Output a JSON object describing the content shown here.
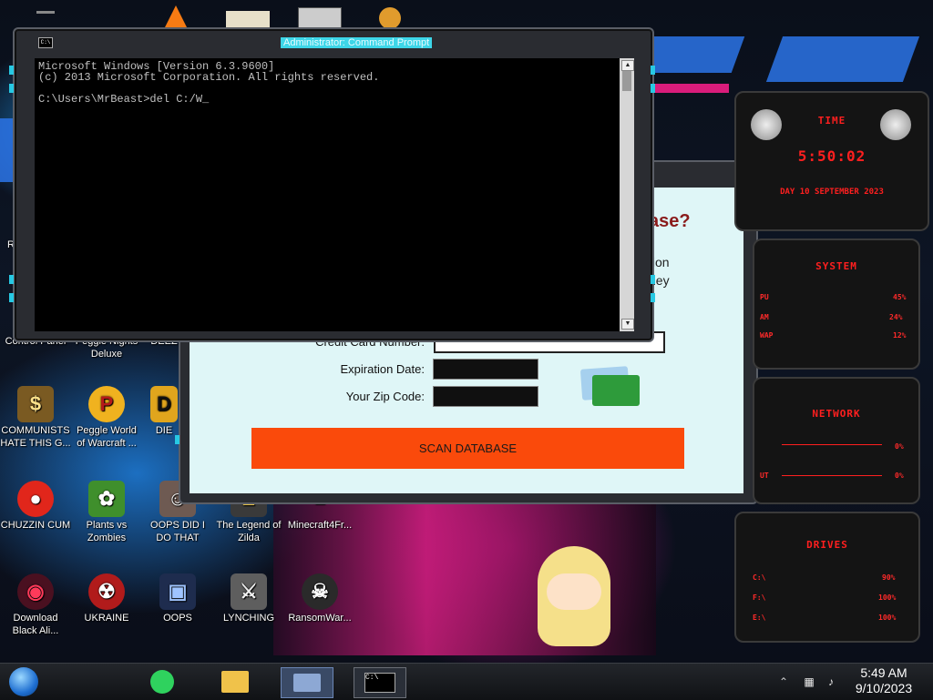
{
  "desktop": {
    "icons": [
      {
        "label": "Control Panel",
        "glyph": "⚙"
      },
      {
        "label": "Peggle Nights Deluxe",
        "glyph": "P"
      },
      {
        "label": "DEEZ",
        "glyph": "D"
      },
      {
        "label": "COMMUNISTS HATE THIS G...",
        "glyph": "$"
      },
      {
        "label": "Peggle World of Warcraft ...",
        "glyph": "P"
      },
      {
        "label": "DIE",
        "glyph": "D"
      },
      {
        "label": "CHUZZIN CUM",
        "glyph": "●"
      },
      {
        "label": "Plants vs Zombies",
        "glyph": "✿"
      },
      {
        "label": "OOPS DID I DO THAT",
        "glyph": "☺"
      },
      {
        "label": "The Legend of Zilda",
        "glyph": "▲"
      },
      {
        "label": "Minecraft4Fr...",
        "glyph": "■"
      },
      {
        "label": "Download Black Ali...",
        "glyph": "◉"
      },
      {
        "label": "UKRAINE",
        "glyph": "☢"
      },
      {
        "label": "OOPS",
        "glyph": "▣"
      },
      {
        "label": "LYNCHING",
        "glyph": "⚔"
      },
      {
        "label": "RansomWar...",
        "glyph": "☠"
      },
      {
        "label": "Re",
        "glyph": "♻"
      }
    ]
  },
  "cmd": {
    "title": "Administrator: Command Prompt",
    "icon_text": "C:\\",
    "lines": [
      "Microsoft Windows [Version 6.3.9600]",
      "(c) 2013 Microsoft Corporation. All rights reserved.",
      "",
      "C:\\Users\\MrBeast>del C:/W_"
    ]
  },
  "scam": {
    "heading_fragment": "ase?",
    "text_lines": [
      "tion",
      "ney"
    ],
    "card_label": "Credit Card Number:",
    "exp_label": "Expiration Date:",
    "zip_label": "Your Zip Code:",
    "button_label": "SCAN DATABASE",
    "heading_color": "#8a1b1b",
    "button_color": "#fa4a0b"
  },
  "gadgets": {
    "time": {
      "title": "TIME",
      "clock": "5:50:02",
      "date": "DAY 10 SEPTEMBER 2023"
    },
    "system": {
      "title": "SYSTEM",
      "rows": [
        {
          "label": "PU",
          "value": "45%"
        },
        {
          "label": "AM",
          "value": "24%"
        },
        {
          "label": "WAP",
          "value": "12%"
        }
      ]
    },
    "network": {
      "title": "NETWORK",
      "rows": [
        {
          "label": "",
          "value": "0%"
        },
        {
          "label": "UT",
          "value": "0%"
        }
      ]
    },
    "drives": {
      "title": "DRIVES",
      "rows": [
        {
          "label": "C:\\",
          "value": "90%"
        },
        {
          "label": "F:\\",
          "value": "100%"
        },
        {
          "label": "E:\\",
          "value": "100%"
        }
      ]
    }
  },
  "taskbar": {
    "clock_time": "5:49 AM",
    "clock_date": "9/10/2023",
    "cmd_icon_text": "C:\\"
  },
  "colors": {
    "accent_cyan": "#27c9e3",
    "gadget_red": "#ff1f1f"
  }
}
